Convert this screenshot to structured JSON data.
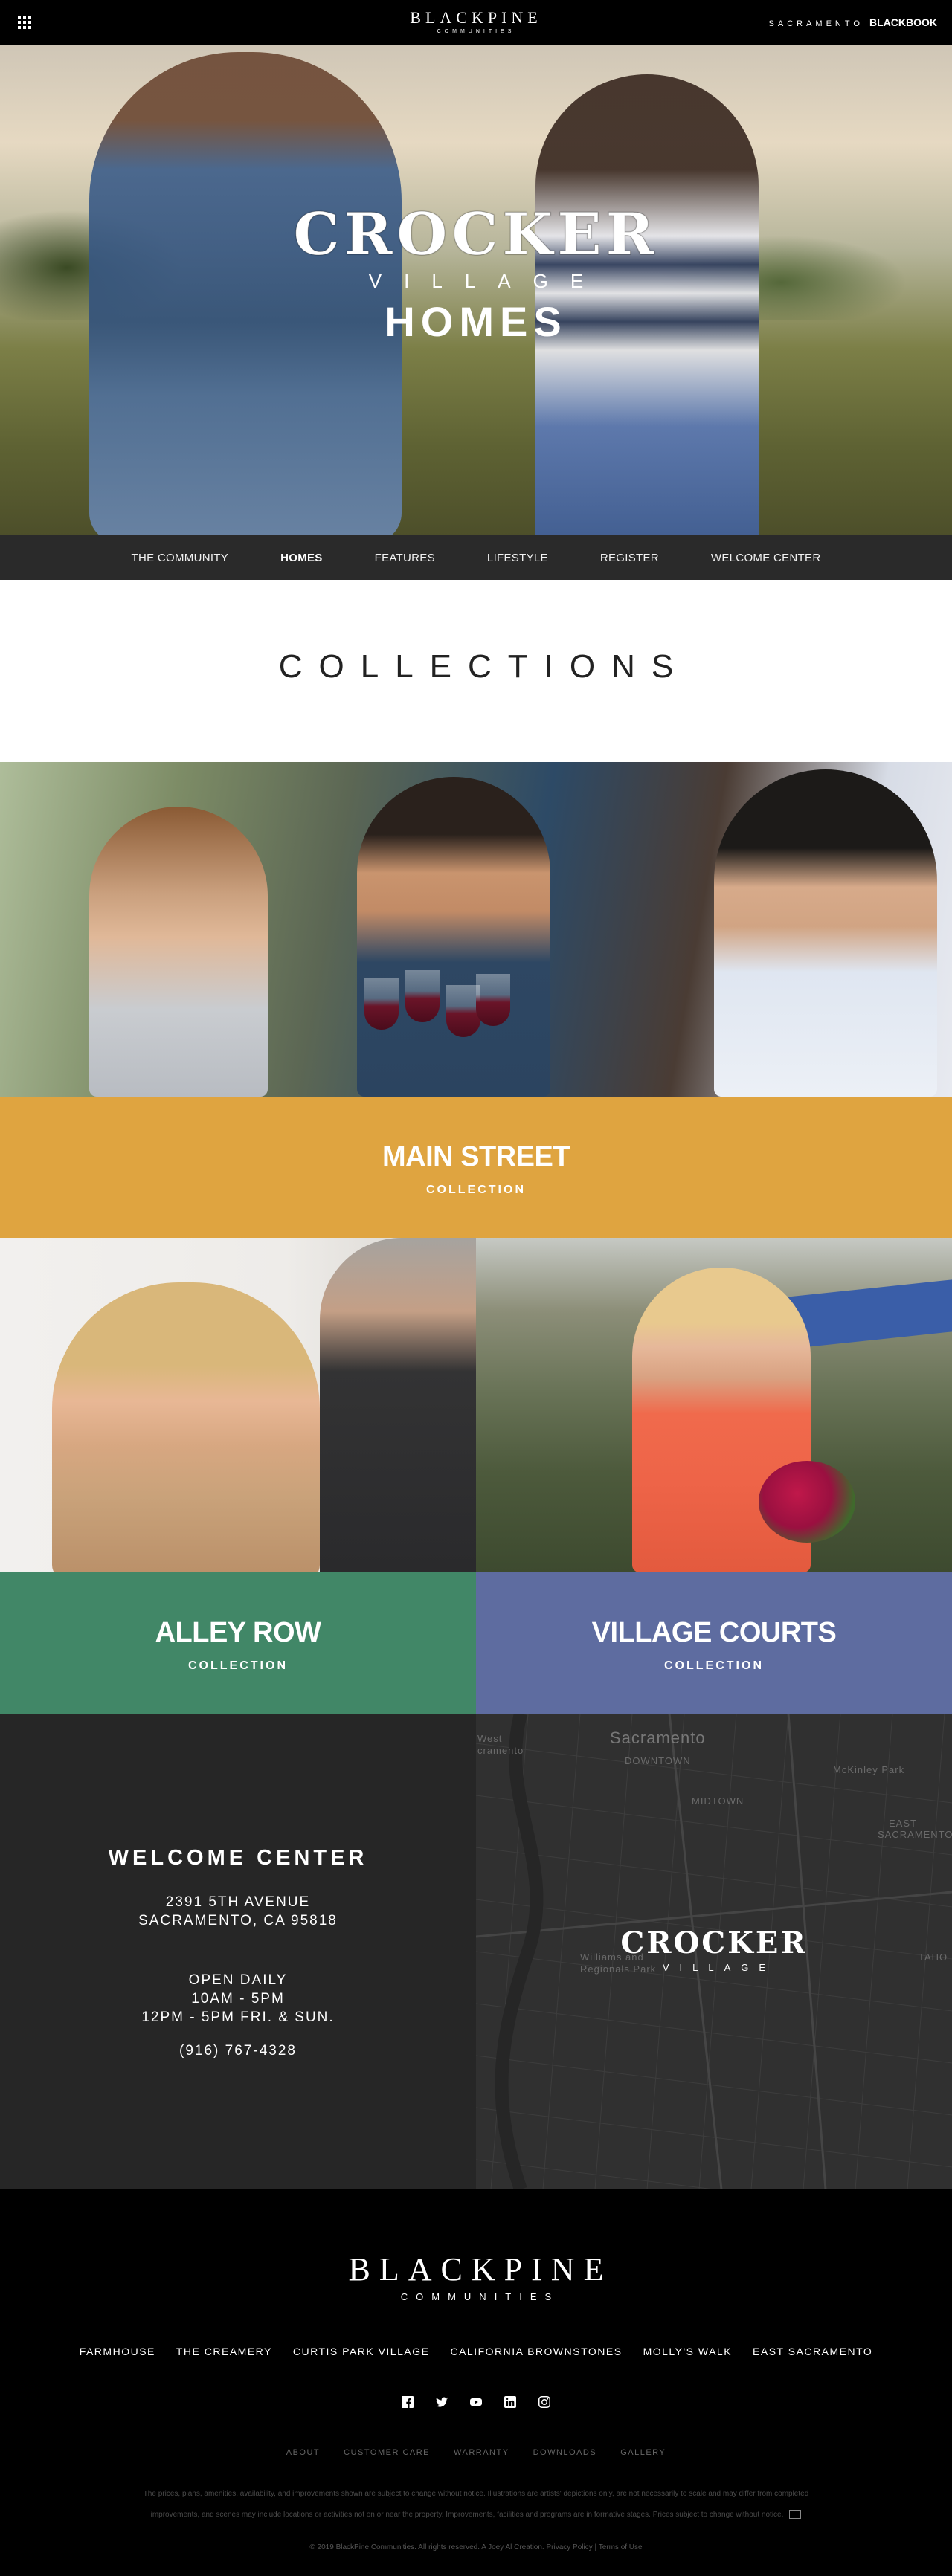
{
  "topbar": {
    "logo_word": "BLACKPINE",
    "logo_sub": "COMMUNITIES",
    "city": "SACRAMENTO",
    "brand_a": "BLACK",
    "brand_b": "BOOK",
    "menu_icon": "grid-menu-icon"
  },
  "hero": {
    "title_line1": "CROCKER",
    "title_line2": "VILLAGE",
    "title_line3": "HOMES"
  },
  "nav": {
    "items": [
      "THE COMMUNITY",
      "HOMES",
      "FEATURES",
      "LIFESTYLE",
      "REGISTER",
      "WELCOME CENTER"
    ],
    "active": "HOMES"
  },
  "collections": {
    "heading": "COLLECTIONS",
    "main_street": {
      "name": "MAIN STREET",
      "sub": "COLLECTION",
      "color": "#dfa440"
    },
    "alley_row": {
      "name": "ALLEY ROW",
      "sub": "COLLECTION",
      "color": "#418767"
    },
    "village_courts": {
      "name": "VILLAGE COURTS",
      "sub": "COLLECTION",
      "color": "#5e6ca0"
    }
  },
  "welcome": {
    "title": "WELCOME CENTER",
    "address_line1": "2391 5TH AVENUE",
    "address_line2": "SACRAMENTO, CA 95818",
    "hours_line1": "OPEN DAILY",
    "hours_line2": "10AM - 5PM",
    "hours_line3": "12PM - 5PM FRI. & SUN.",
    "phone": "(916) 767-4328"
  },
  "map": {
    "labels": {
      "sacramento": "Sacramento",
      "downtown": "DOWNTOWN",
      "midtown": "MIDTOWN",
      "mckinley": "McKinley Park",
      "east_sac_1": "EAST",
      "east_sac_2": "SACRAMENTO",
      "west_sac_1": "West",
      "west_sac_2": "cramento",
      "williams": "Williams and",
      "regionals": "Regionals Park",
      "tahoe": "TAHO"
    },
    "logo_line1": "CROCKER",
    "logo_line2": "VILLAGE"
  },
  "footer": {
    "logo_word": "BLACKPINE",
    "logo_sub": "COMMUNITIES",
    "links": [
      "FARMHOUSE",
      "THE CREAMERY",
      "CURTIS PARK VILLAGE",
      "CALIFORNIA BROWNSTONES",
      "MOLLY'S WALK",
      "EAST SACRAMENTO"
    ],
    "social_icons": [
      "facebook-icon",
      "twitter-icon",
      "youtube-icon",
      "linkedin-icon",
      "instagram-icon"
    ],
    "legal_links": [
      "ABOUT",
      "CUSTOMER CARE",
      "WARRANTY",
      "DOWNLOADS",
      "GALLERY"
    ],
    "disclaimer_line1": "The prices, plans, amenities, availability, and improvements shown are subject to change without notice. Illustrations are artists' depictions only, are not necessarily to scale and may differ from completed",
    "disclaimer_line2": "improvements, and scenes may include locations or activities not on or near the property. Improvements, facilities and programs are in formative stages. Prices subject to change without notice.",
    "copyright": "© 2019 BlackPine Communities. All rights reserved. A Joey Al Creation. Privacy Policy | Terms of Use"
  }
}
